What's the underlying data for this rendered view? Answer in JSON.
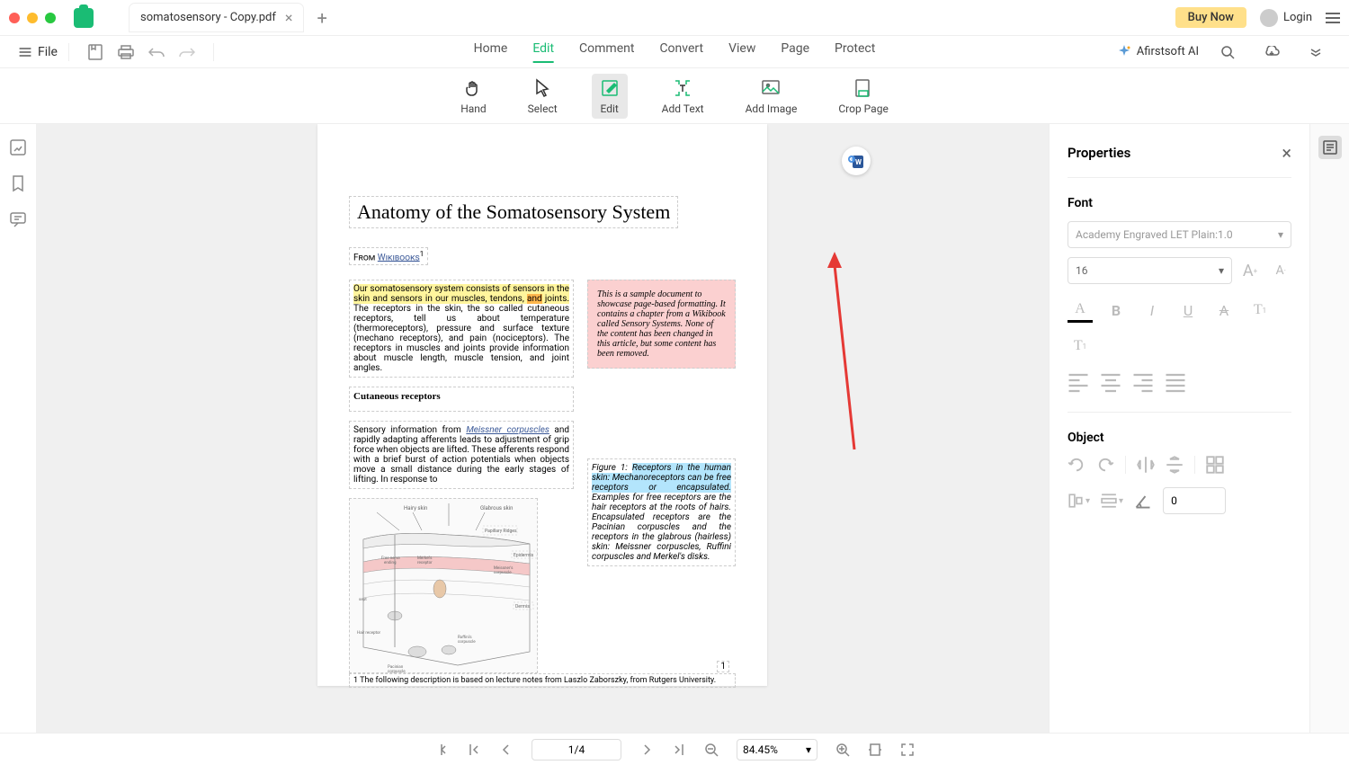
{
  "titlebar": {
    "tab_name": "somatosensory - Copy.pdf",
    "buy_now": "Buy Now",
    "login": "Login"
  },
  "toolbar": {
    "file": "File",
    "nav": [
      "Home",
      "Edit",
      "Comment",
      "Convert",
      "View",
      "Page",
      "Protect"
    ],
    "active_nav": "Edit",
    "ai_label": "Afirstsoft AI"
  },
  "subtoolbar": {
    "hand": "Hand",
    "select": "Select",
    "edit": "Edit",
    "add_text": "Add Text",
    "add_image": "Add Image",
    "crop_page": "Crop Page"
  },
  "document": {
    "title": "Anatomy of the Somatosensory System",
    "from_label": "From ",
    "wikibooks": "Wikibooks",
    "sup": "1",
    "intro_highlight": "Our somatosensory system consists of sensors in the skin and sensors in our muscles, tendons, ",
    "intro_and": "and",
    "intro_rest": " joints.",
    "intro_cont": " The receptors in the skin, the so called cutaneous receptors, tell us about temperature (thermoreceptors), pressure and surface texture (mechano receptors), and pain (nociceptors). The receptors in muscles and joints provide information about muscle length, muscle tension, and joint angles.",
    "pink_note": "This is a sample document to showcase page-based formatting. It contains a chapter from a Wikibook called Sensory Systems. None of the content has been changed in this article, but some content has been removed.",
    "subhead": "Cutaneous receptors",
    "para2_a": "Sensory information from ",
    "para2_link": "Meissner corpuscles",
    "para2_b": " and rapidly adapting afferents leads to adjustment of grip force when objects are lifted. These afferents respond with a brief burst of action potentials when objects move a small distance during the early stages of lifting. In response to",
    "fig_label": "Figure 1: ",
    "fig_blue": "Receptors in the human skin: Mechanoreceptors can be free receptors or encapsulated.",
    "fig_rest": " Examples for free receptors are the hair receptors at the roots of hairs. Encapsulated receptors are the Pacinian corpuscles and the receptors in the glabrous (hairless) skin: Meissner corpuscles, Ruffini corpuscles and Merkel's disks.",
    "footnote": "1 The following description is based on lecture notes from Laszlo Zaborszky, from Rutgers University.",
    "page_num": "1",
    "diagram_labels": {
      "hairy_skin": "Hairy skin",
      "glabrous_skin": "Glabrous skin",
      "papillary": "Papillary Ridges",
      "epidermis": "Epidermis",
      "dermis": "Dermis",
      "free_nerve": "Free nerve ending",
      "merkels": "Merkel's receptor",
      "meissner": "Meissner's corpuscle",
      "hair_receptor": "Hair receptor",
      "pacinian": "Pacinian corpuscle",
      "ruffinis": "Ruffini's corpuscle",
      "sept": "sept"
    }
  },
  "properties": {
    "title": "Properties",
    "font_label": "Font",
    "font_name": "Academy Engraved LET Plain:1.0",
    "font_size": "16",
    "object_label": "Object",
    "rotation": "0"
  },
  "bottombar": {
    "page": "1/4",
    "zoom": "84.45%"
  }
}
